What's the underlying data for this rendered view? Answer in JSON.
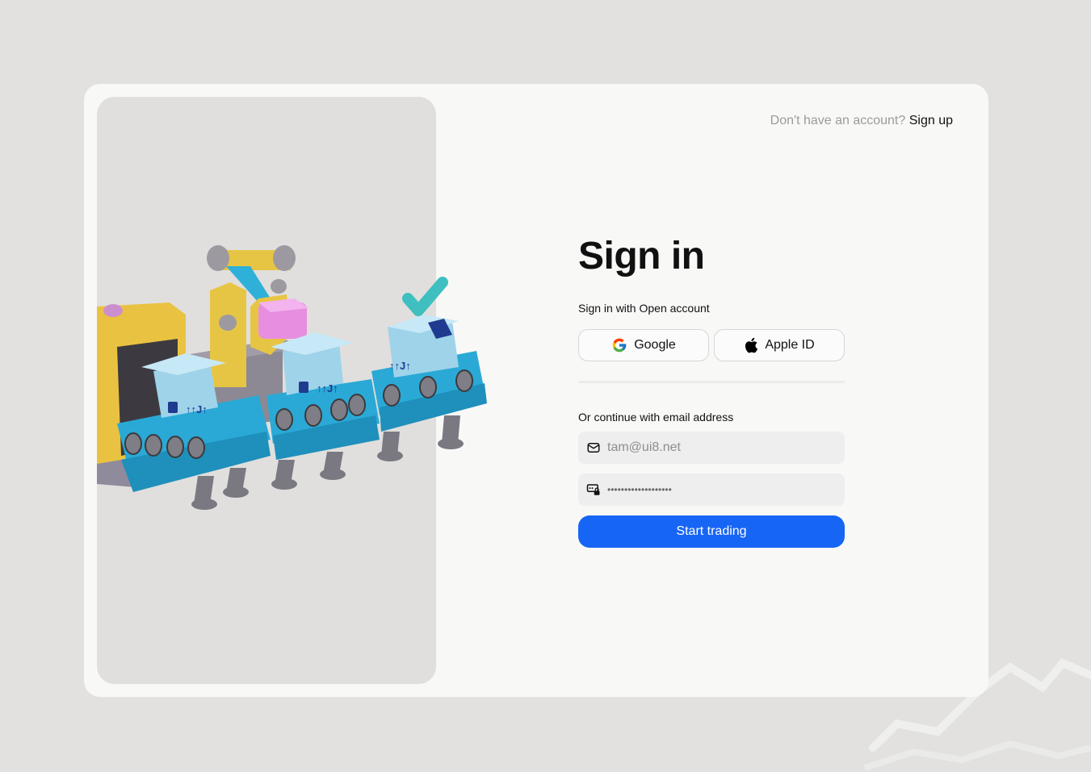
{
  "header": {
    "signup_prompt": "Don't have an account?",
    "signup_link": "Sign up"
  },
  "form": {
    "title": "Sign in",
    "subtitle": "Sign in with Open account",
    "social": {
      "google_label": "Google",
      "apple_label": "Apple ID"
    },
    "email_section_label": "Or continue with email address",
    "email": {
      "placeholder": "tam@ui8.net",
      "icon": "mail-icon"
    },
    "password": {
      "masked_value": "•••••••••••••••••••",
      "icon": "password-lock-icon"
    },
    "submit_label": "Start trading"
  },
  "illustration": {
    "icon": "conveyor-belt-boxes-illustration"
  },
  "colors": {
    "accent": "#1765f5",
    "page_background": "#e2e1df",
    "card_background": "#f8f8f7",
    "panel_background": "#e0dfdd"
  }
}
